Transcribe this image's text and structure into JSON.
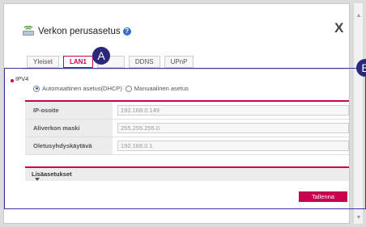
{
  "dialog": {
    "title": "Verkon perusasetus",
    "help_icon": "?",
    "close_label": "X"
  },
  "tabs": [
    {
      "label": "Yleiset",
      "active": false
    },
    {
      "label": "LAN1",
      "active": true
    },
    {
      "label": "",
      "active": false
    },
    {
      "label": "DDNS",
      "active": false
    },
    {
      "label": "UPnP",
      "active": false
    }
  ],
  "section": {
    "label": "IPV4",
    "radio_dhcp": "Automaattinen asetus(DHCP)",
    "radio_manual": "Manuaalinen asetus",
    "selected": "dhcp"
  },
  "form": {
    "rows": [
      {
        "label": "IP-osoite",
        "value": "192.168.0.149"
      },
      {
        "label": "Aliverkon maski",
        "value": "255.255.255.0"
      },
      {
        "label": "Oletusyhdyskäytävä",
        "value": "192.168.0.1"
      }
    ]
  },
  "advanced": {
    "label": "Lisäasetukset"
  },
  "save_label": "Tallenna",
  "annotations": {
    "a": "A",
    "b": "B"
  },
  "colors": {
    "accent": "#c9004d",
    "annotation": "#2a2879"
  }
}
